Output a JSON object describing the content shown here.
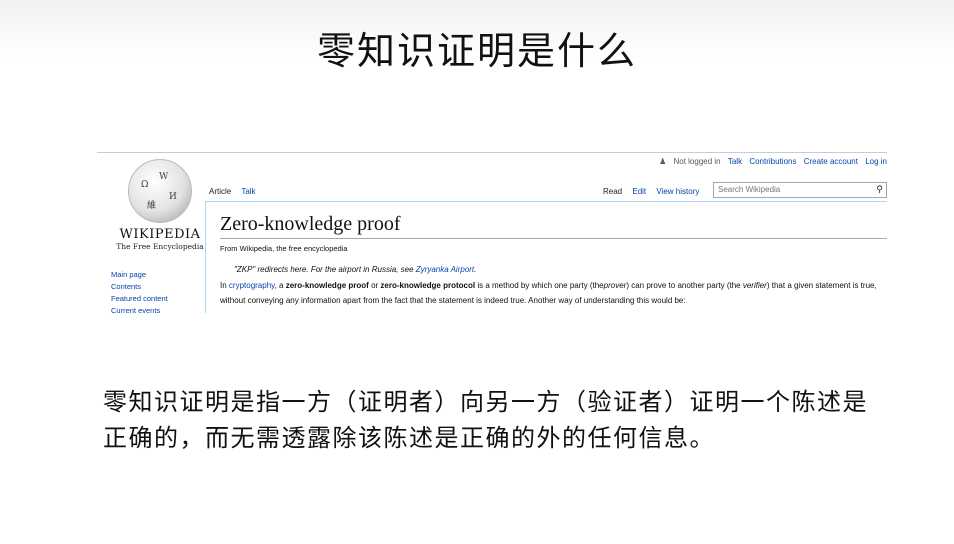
{
  "slide": {
    "title": "零知识证明是什么",
    "body": "零知识证明是指一方（证明者）向另一方（验证者）证明一个陈述是正确的，而无需透露除该陈述是正确的外的任何信息。"
  },
  "wiki": {
    "user_bar": {
      "not_logged_in": "Not logged in",
      "talk": "Talk",
      "contributions": "Contributions",
      "create_account": "Create account",
      "log_in": "Log in"
    },
    "logo": {
      "wordmark": "WIKIPEDIA",
      "tagline": "The Free Encyclopedia"
    },
    "sidebar": [
      "Main page",
      "Contents",
      "Featured content",
      "Current events"
    ],
    "tabs_left": [
      "Article",
      "Talk"
    ],
    "tabs_right": [
      "Read",
      "Edit",
      "View history"
    ],
    "search_placeholder": "Search Wikipedia",
    "article": {
      "title": "Zero-knowledge proof",
      "from": "From Wikipedia, the free encyclopedia",
      "hatnote": {
        "text": "\"ZKP\" redirects here. For the airport in Russia, see",
        "link": "Zyryanka Airport",
        "end": "."
      },
      "para": {
        "in": "In",
        "cryptography": "cryptography",
        "a": ", a",
        "zkp": "zero-knowledge proof",
        "or": "or",
        "zkprot": "zero-knowledge protocol",
        "rest1": "is a method by which one party (the",
        "prover": "prover",
        "rest2": ") can prove to another party (the",
        "verifier": "verifier",
        "rest3": ") that a given statement is true, without conveying any information apart from the fact that the statement is indeed true. Another way of understanding this would be:"
      }
    },
    "colors": {
      "link": "#0645ad",
      "tab_border": "#a7d7f9"
    }
  }
}
